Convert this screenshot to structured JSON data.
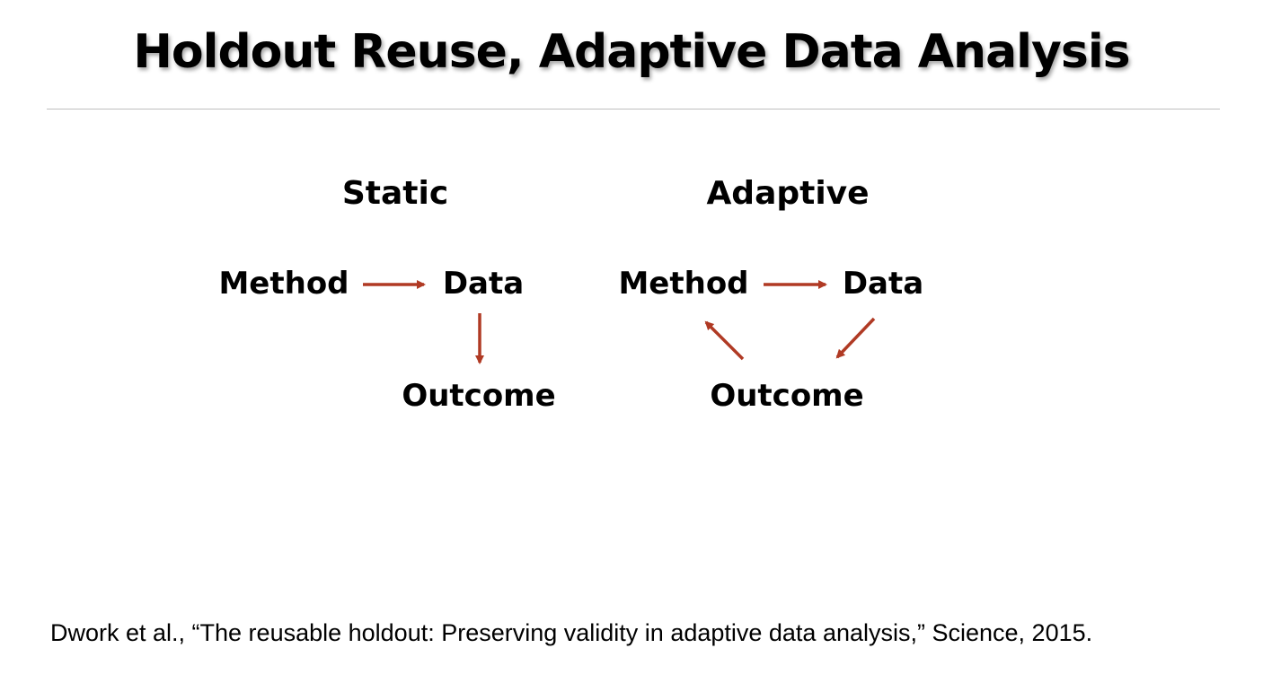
{
  "title": "Holdout Reuse, Adaptive Data Analysis",
  "static": {
    "heading": "Static",
    "method": "Method",
    "data": "Data",
    "outcome": "Outcome"
  },
  "adaptive": {
    "heading": "Adaptive",
    "method": "Method",
    "data": "Data",
    "outcome": "Outcome"
  },
  "arrow_color": "#b03a24",
  "citation": "Dwork et al., “The reusable holdout: Preserving validity in adaptive data analysis,” Science, 2015."
}
